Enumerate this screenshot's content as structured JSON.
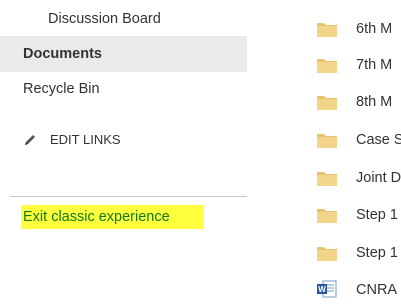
{
  "nav": {
    "discussion_board": "Discussion Board",
    "documents": "Documents",
    "recycle_bin": "Recycle Bin",
    "edit_links": "EDIT LINKS",
    "exit_classic": "Exit classic experience"
  },
  "files": [
    {
      "name": "6th M",
      "icon": "folder-icon"
    },
    {
      "name": "7th M",
      "icon": "folder-icon"
    },
    {
      "name": "8th M",
      "icon": "folder-icon"
    },
    {
      "name": "Case S",
      "icon": "folder-icon"
    },
    {
      "name": "Joint D",
      "icon": "folder-icon"
    },
    {
      "name": "Step 1",
      "icon": "folder-icon"
    },
    {
      "name": "Step 1",
      "icon": "folder-icon"
    },
    {
      "name": "CNRA",
      "icon": "word-document-icon"
    }
  ],
  "colors": {
    "folder": "#e8c26e",
    "word_blue": "#2b579a",
    "highlight": "#ffff3d",
    "link_green": "#0f7a1b",
    "selected_bg": "#eaeaea"
  }
}
